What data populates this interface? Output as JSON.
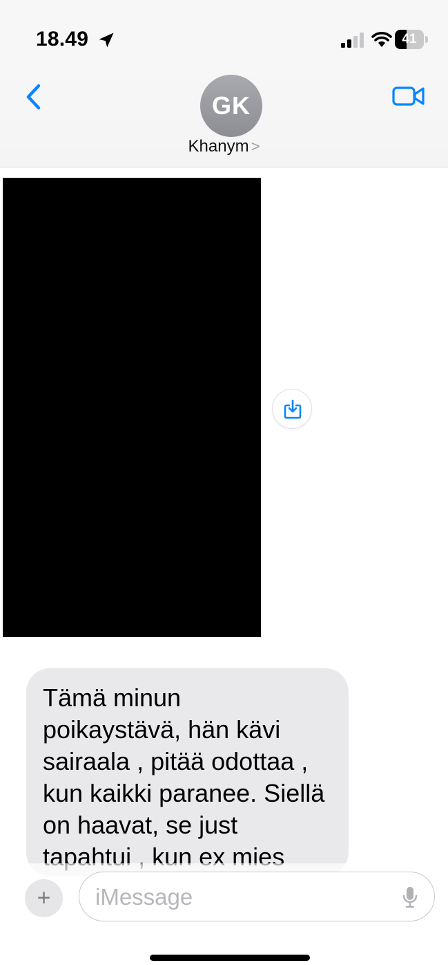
{
  "status_bar": {
    "time": "18.49",
    "battery_level": "41",
    "icons": [
      "location-arrow-icon",
      "cellular-signal-icon",
      "wifi-icon",
      "battery-icon"
    ]
  },
  "header": {
    "avatar_initials": "GK",
    "contact_name": "Khanym",
    "contact_chevron": ">",
    "icons": [
      "back-chevron-icon",
      "video-camera-icon"
    ],
    "accent_color": "#0a84ff"
  },
  "conversation": {
    "media_icon": "save-download-icon",
    "messages": [
      {
        "direction": "incoming",
        "text": "Tämä minun\npoikaystävä, hän kävi\nsairaala , pitää odottaa ,\nkun kaikki paranee. Siellä\non haavat, se just\ntapahtui , kun ex mies"
      }
    ]
  },
  "composer": {
    "plus_label": "+",
    "placeholder": "iMessage",
    "icons": [
      "plus-icon",
      "microphone-icon"
    ]
  }
}
